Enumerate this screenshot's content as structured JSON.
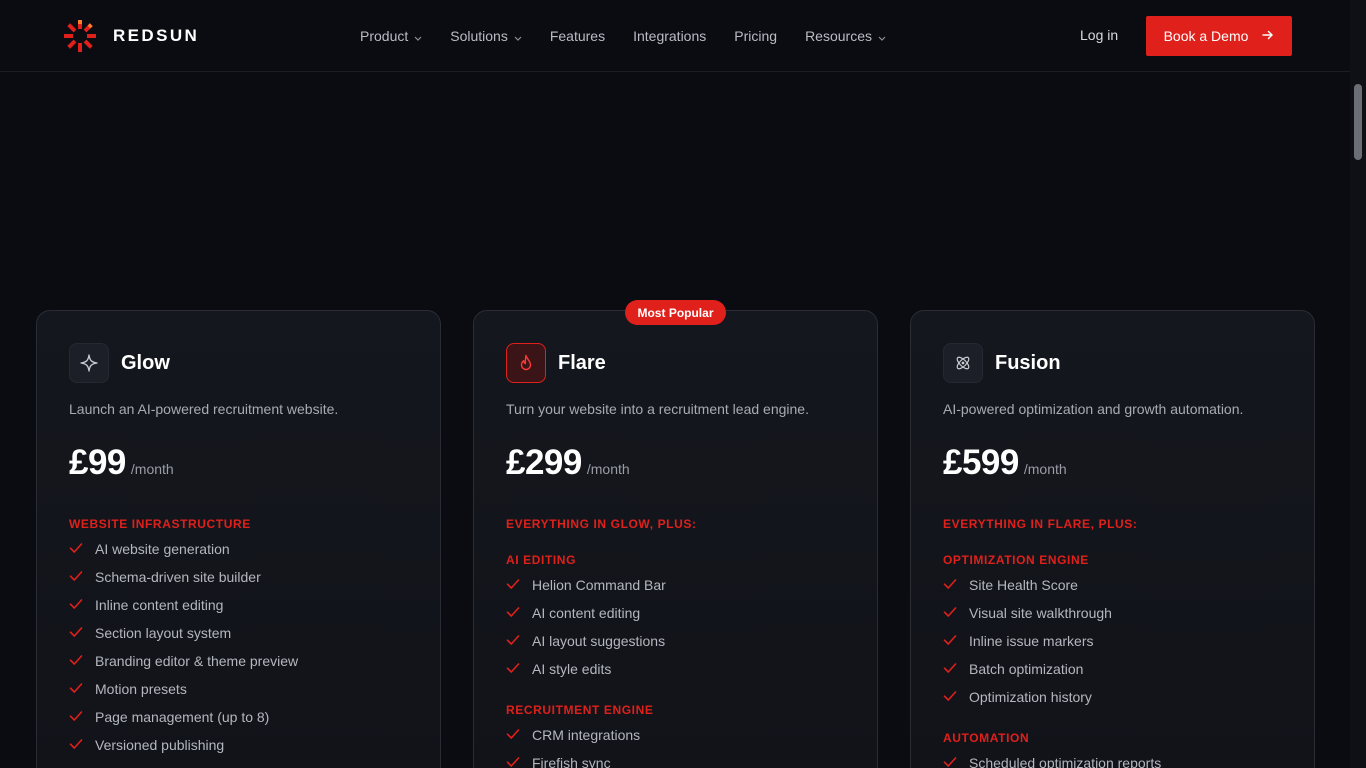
{
  "brand": {
    "name": "REDSUN",
    "accent": "#e0201b",
    "logo_icon": "sun-burst-icon"
  },
  "nav": {
    "items": [
      {
        "label": "Product",
        "has_dropdown": true
      },
      {
        "label": "Solutions",
        "has_dropdown": true
      },
      {
        "label": "Features",
        "has_dropdown": false
      },
      {
        "label": "Integrations",
        "has_dropdown": false
      },
      {
        "label": "Pricing",
        "has_dropdown": false
      },
      {
        "label": "Resources",
        "has_dropdown": true
      }
    ],
    "login": "Log in",
    "cta": "Book a Demo",
    "cta_icon": "arrow-right-icon"
  },
  "pricing": {
    "badge": "Most Popular",
    "plans": [
      {
        "name": "Glow",
        "icon": "sparkle-icon",
        "description": "Launch an AI-powered recruitment website.",
        "price": "£99",
        "period": "/month",
        "sections": [
          {
            "title": "WEBSITE INFRASTRUCTURE",
            "items": [
              "AI website generation",
              "Schema-driven site builder",
              "Inline content editing",
              "Section layout system",
              "Branding editor & theme preview",
              "Motion presets",
              "Page management (up to 8)",
              "Versioned publishing"
            ]
          }
        ]
      },
      {
        "name": "Flare",
        "icon": "flame-icon",
        "description": "Turn your website into a recruitment lead engine.",
        "price": "£299",
        "period": "/month",
        "intro": "EVERYTHING IN GLOW, PLUS:",
        "sections": [
          {
            "title": "AI EDITING",
            "items": [
              "Helion Command Bar",
              "AI content editing",
              "AI layout suggestions",
              "AI style edits"
            ]
          },
          {
            "title": "RECRUITMENT ENGINE",
            "items": [
              "CRM integrations",
              "Firefish sync"
            ]
          }
        ]
      },
      {
        "name": "Fusion",
        "icon": "atom-icon",
        "description": "AI-powered optimization and growth automation.",
        "price": "£599",
        "period": "/month",
        "intro": "EVERYTHING IN FLARE, PLUS:",
        "sections": [
          {
            "title": "OPTIMIZATION ENGINE",
            "items": [
              "Site Health Score",
              "Visual site walkthrough",
              "Inline issue markers",
              "Batch optimization",
              "Optimization history"
            ]
          },
          {
            "title": "AUTOMATION",
            "items": [
              "Scheduled optimization reports"
            ]
          }
        ]
      }
    ]
  }
}
